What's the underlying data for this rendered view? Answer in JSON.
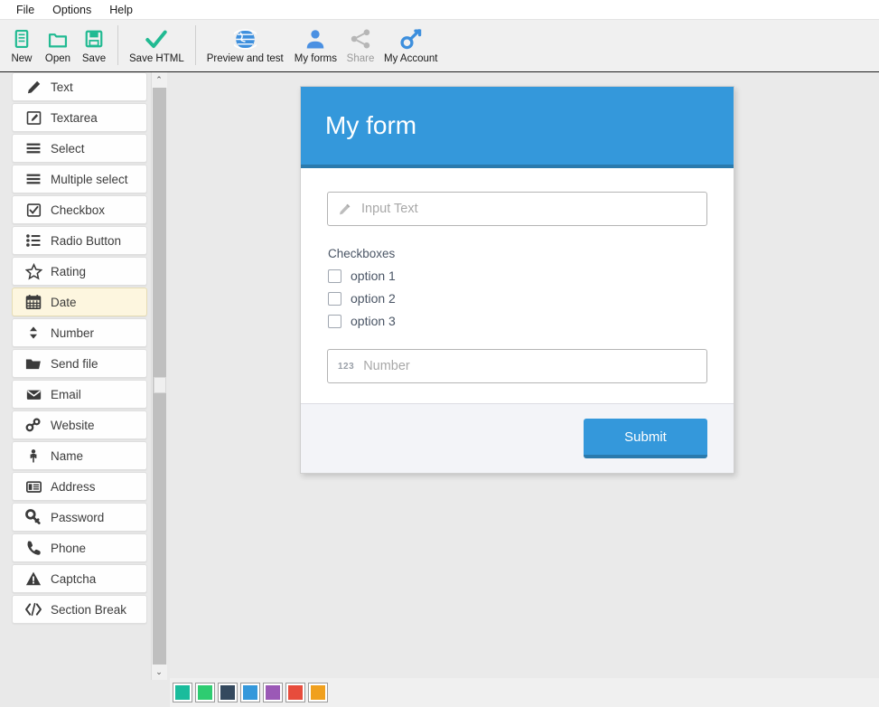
{
  "menubar": {
    "items": [
      {
        "label": "File",
        "name": "menu-file"
      },
      {
        "label": "Options",
        "name": "menu-options"
      },
      {
        "label": "Help",
        "name": "menu-help"
      }
    ]
  },
  "toolbar": {
    "buttons": [
      {
        "label": "New",
        "icon": "document-icon",
        "color": "#21ba92",
        "disabled": false,
        "sep_after": false
      },
      {
        "label": "Open",
        "icon": "folder-icon",
        "color": "#21ba92",
        "disabled": false,
        "sep_after": false
      },
      {
        "label": "Save",
        "icon": "floppy-disk-icon",
        "color": "#21ba92",
        "disabled": false,
        "sep_after": true
      },
      {
        "label": "Save HTML",
        "icon": "checkmark-icon",
        "color": "#21ba92",
        "disabled": false,
        "sep_after": true
      },
      {
        "label": "Preview and test",
        "icon": "globe-icon",
        "color": "#3d8fdd",
        "disabled": false,
        "sep_after": false
      },
      {
        "label": "My forms",
        "icon": "person-icon",
        "color": "#4a90e2",
        "disabled": false,
        "sep_after": false
      },
      {
        "label": "Share",
        "icon": "share-nodes-icon",
        "color": "#b6b6b6",
        "disabled": true,
        "sep_after": false
      },
      {
        "label": "My Account",
        "icon": "key-icon",
        "color": "#3d8fdd",
        "disabled": false,
        "sep_after": false
      }
    ]
  },
  "sidebar": {
    "items": [
      {
        "label": "Text",
        "icon": "pencil-icon",
        "active": false
      },
      {
        "label": "Textarea",
        "icon": "textarea-pencil-icon",
        "active": false
      },
      {
        "label": "Select",
        "icon": "list-lines-icon",
        "active": false
      },
      {
        "label": "Multiple select",
        "icon": "list-lines-icon",
        "active": false
      },
      {
        "label": "Checkbox",
        "icon": "checkbox-checked-icon",
        "active": false
      },
      {
        "label": "Radio Button",
        "icon": "radio-list-icon",
        "active": false
      },
      {
        "label": "Rating",
        "icon": "star-outline-icon",
        "active": false
      },
      {
        "label": "Date",
        "icon": "calendar-icon",
        "active": true
      },
      {
        "label": "Number",
        "icon": "up-down-arrows-icon",
        "active": false
      },
      {
        "label": "Send file",
        "icon": "open-folder-icon",
        "active": false
      },
      {
        "label": "Email",
        "icon": "envelope-icon",
        "active": false
      },
      {
        "label": "Website",
        "icon": "link-chain-icon",
        "active": false
      },
      {
        "label": "Name",
        "icon": "person-figure-icon",
        "active": false
      },
      {
        "label": "Address",
        "icon": "address-card-icon",
        "active": false
      },
      {
        "label": "Password",
        "icon": "key-solid-icon",
        "active": false
      },
      {
        "label": "Phone",
        "icon": "phone-handset-icon",
        "active": false
      },
      {
        "label": "Captcha",
        "icon": "warning-triangle-icon",
        "active": false
      },
      {
        "label": "Section Break",
        "icon": "code-tags-icon",
        "active": false
      }
    ],
    "scroll": {
      "up_arrow": "⌃",
      "down_arrow": "⌄"
    }
  },
  "form": {
    "title": "My form",
    "header_color": "#3498db",
    "header_border_color": "#2a7aad",
    "text_field": {
      "placeholder": "Input Text",
      "value": "",
      "icon": "pencil-icon"
    },
    "checkbox_group": {
      "label": "Checkboxes",
      "options": [
        {
          "label": "option 1",
          "checked": false
        },
        {
          "label": "option 2",
          "checked": false
        },
        {
          "label": "option 3",
          "checked": false
        }
      ]
    },
    "number_field": {
      "placeholder": "Number",
      "value": "",
      "icon": "123-icon",
      "icon_text": "123"
    },
    "submit_label": "Submit"
  },
  "palette": {
    "swatches": [
      {
        "color": "#1abc9c",
        "name": "swatch-turquoise"
      },
      {
        "color": "#2ecc71",
        "name": "swatch-green"
      },
      {
        "color": "#34495e",
        "name": "swatch-dark-navy"
      },
      {
        "color": "#3498db",
        "name": "swatch-blue"
      },
      {
        "color": "#9b59b6",
        "name": "swatch-purple"
      },
      {
        "color": "#e74c3c",
        "name": "swatch-red"
      },
      {
        "color": "#f0a01e",
        "name": "swatch-orange"
      }
    ]
  }
}
